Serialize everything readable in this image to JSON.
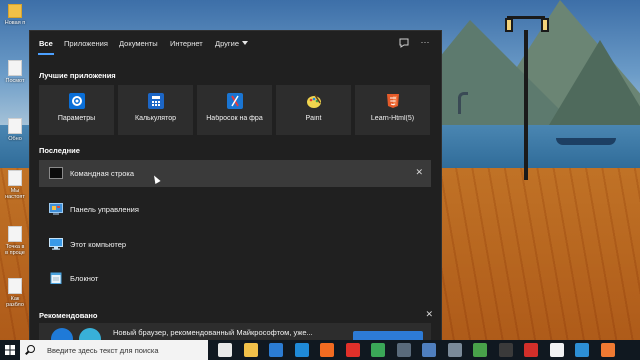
{
  "desktop": {
    "icons": [
      {
        "label": "Новая п",
        "type": "folder"
      },
      {
        "label": "Посмот",
        "type": "file"
      },
      {
        "label": "Обно",
        "type": "file"
      },
      {
        "label": "Мы",
        "type": "file"
      },
      {
        "label": "настоят",
        "type": "file"
      },
      {
        "label": "Точка в",
        "type": "file"
      },
      {
        "label": "в проце",
        "type": "file"
      },
      {
        "label": "Как",
        "type": "file"
      },
      {
        "label": "разбло",
        "type": "file"
      }
    ]
  },
  "search_panel": {
    "tabs": [
      {
        "label": "Все",
        "active": true
      },
      {
        "label": "Приложения",
        "active": false
      },
      {
        "label": "Документы",
        "active": false
      },
      {
        "label": "Интернет",
        "active": false
      },
      {
        "label": "Другие",
        "active": false,
        "has_dropdown": true
      }
    ],
    "feedback_icon": "feedback-icon",
    "more_icon": "more-options-icon",
    "more_label": "···",
    "best_apps_title": "Лучшие приложения",
    "best_apps": [
      {
        "label": "Параметры",
        "icon": "settings-gear-icon",
        "color": "#0a6fd8"
      },
      {
        "label": "Калькулятор",
        "icon": "calculator-icon",
        "color": "#1c66c6"
      },
      {
        "label": "Набросок на фра",
        "icon": "snip-sketch-icon",
        "color": "#1a75d2"
      },
      {
        "label": "Paint",
        "icon": "paint-palette-icon",
        "color": "#f0d54e"
      },
      {
        "label": "Learn-Html(5)",
        "icon": "html5-icon",
        "color": "#e55b2a"
      }
    ],
    "recent_title": "Последние",
    "recent": [
      {
        "label": "Командная строка",
        "icon": "command-prompt-icon",
        "selected": true,
        "close": "✕"
      },
      {
        "label": "Панель управления",
        "icon": "control-panel-icon",
        "selected": false
      },
      {
        "label": "Этот компьютер",
        "icon": "this-pc-icon",
        "selected": false
      },
      {
        "label": "Блокнот",
        "icon": "notepad-icon",
        "selected": false
      }
    ],
    "recommended_title": "Рекомендовано",
    "recommended_close": "✕",
    "recommended_item": "Новый браузер, рекомендованный Майкрософтом, уже..."
  },
  "taskbar": {
    "search_placeholder": "Введите здесь текст для поиска",
    "icons": [
      {
        "name": "task-view-icon",
        "color": "#e8e8e8"
      },
      {
        "name": "file-explorer-icon",
        "color": "#f2c14a"
      },
      {
        "name": "store-icon",
        "color": "#2b7cd3"
      },
      {
        "name": "mail-icon",
        "color": "#1f8ad8"
      },
      {
        "name": "firefox-icon",
        "color": "#f26b21"
      },
      {
        "name": "opera-icon",
        "color": "#e0302a"
      },
      {
        "name": "chrome-icon",
        "color": "#3aa757"
      },
      {
        "name": "app-icon-8",
        "color": "#5a6b7c"
      },
      {
        "name": "app-icon-9",
        "color": "#4f7fbf"
      },
      {
        "name": "app-icon-10",
        "color": "#7b8a99"
      },
      {
        "name": "camtasia-icon",
        "color": "#49a24a"
      },
      {
        "name": "app-icon-12",
        "color": "#3a3a3a"
      },
      {
        "name": "opera-gx-icon",
        "color": "#d22f2a"
      },
      {
        "name": "yandex-icon",
        "color": "#f2f2f2"
      },
      {
        "name": "app-icon-15",
        "color": "#2d8fd5"
      },
      {
        "name": "app-icon-16",
        "color": "#f07a32"
      }
    ]
  }
}
